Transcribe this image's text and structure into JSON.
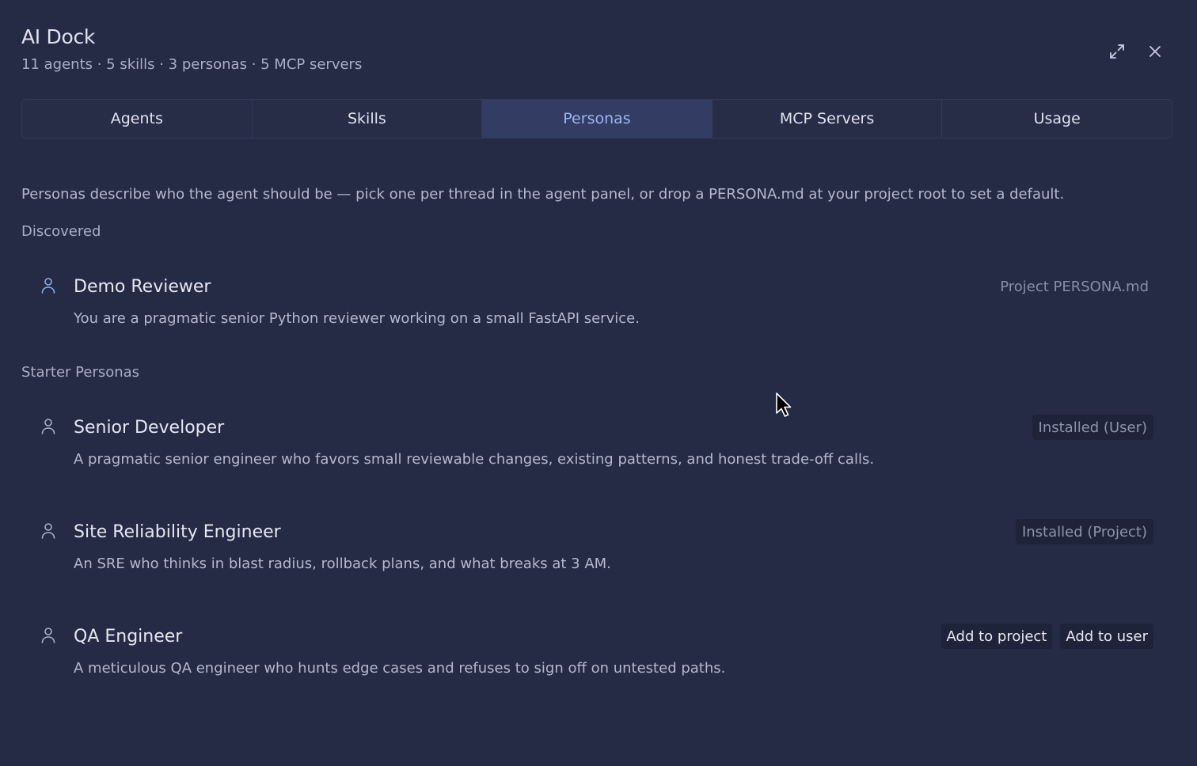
{
  "app": {
    "title": "AI Dock",
    "summary": "11 agents · 5 skills · 3 personas · 5 MCP servers"
  },
  "window_controls": {
    "expand_icon": "expand-icon",
    "close_icon": "close-icon"
  },
  "tabs": [
    {
      "label": "Agents",
      "active": false
    },
    {
      "label": "Skills",
      "active": false
    },
    {
      "label": "Personas",
      "active": true
    },
    {
      "label": "MCP Servers",
      "active": false
    },
    {
      "label": "Usage",
      "active": false
    }
  ],
  "intro": "Personas describe who the agent should be — pick one per thread in the agent panel, or drop a PERSONA.md at your project root to set a default.",
  "discovered": {
    "heading": "Discovered",
    "items": [
      {
        "name": "Demo Reviewer",
        "description": "You are a pragmatic senior Python reviewer working on a small FastAPI service.",
        "source": "Project PERSONA.md",
        "icon": "person-icon"
      }
    ]
  },
  "starter": {
    "heading": "Starter Personas",
    "items": [
      {
        "name": "Senior Developer",
        "description": "A pragmatic senior engineer who favors small reviewable changes, existing patterns, and honest trade-off calls.",
        "badge": "Installed (User)",
        "icon": "person-icon"
      },
      {
        "name": "Site Reliability Engineer",
        "description": "An SRE who thinks in blast radius, rollback plans, and what breaks at 3 AM.",
        "badge": "Installed (Project)",
        "icon": "person-icon"
      },
      {
        "name": "QA Engineer",
        "description": "A meticulous QA engineer who hunts edge cases and refuses to sign off on untested paths.",
        "actions": [
          "Add to project",
          "Add to user"
        ],
        "icon": "person-icon"
      }
    ]
  },
  "colors": {
    "background": "#262b45",
    "active_tab_bg": "#333c62",
    "active_tab_text": "#9db4f6",
    "accent_icon": "#8fa8ee"
  }
}
